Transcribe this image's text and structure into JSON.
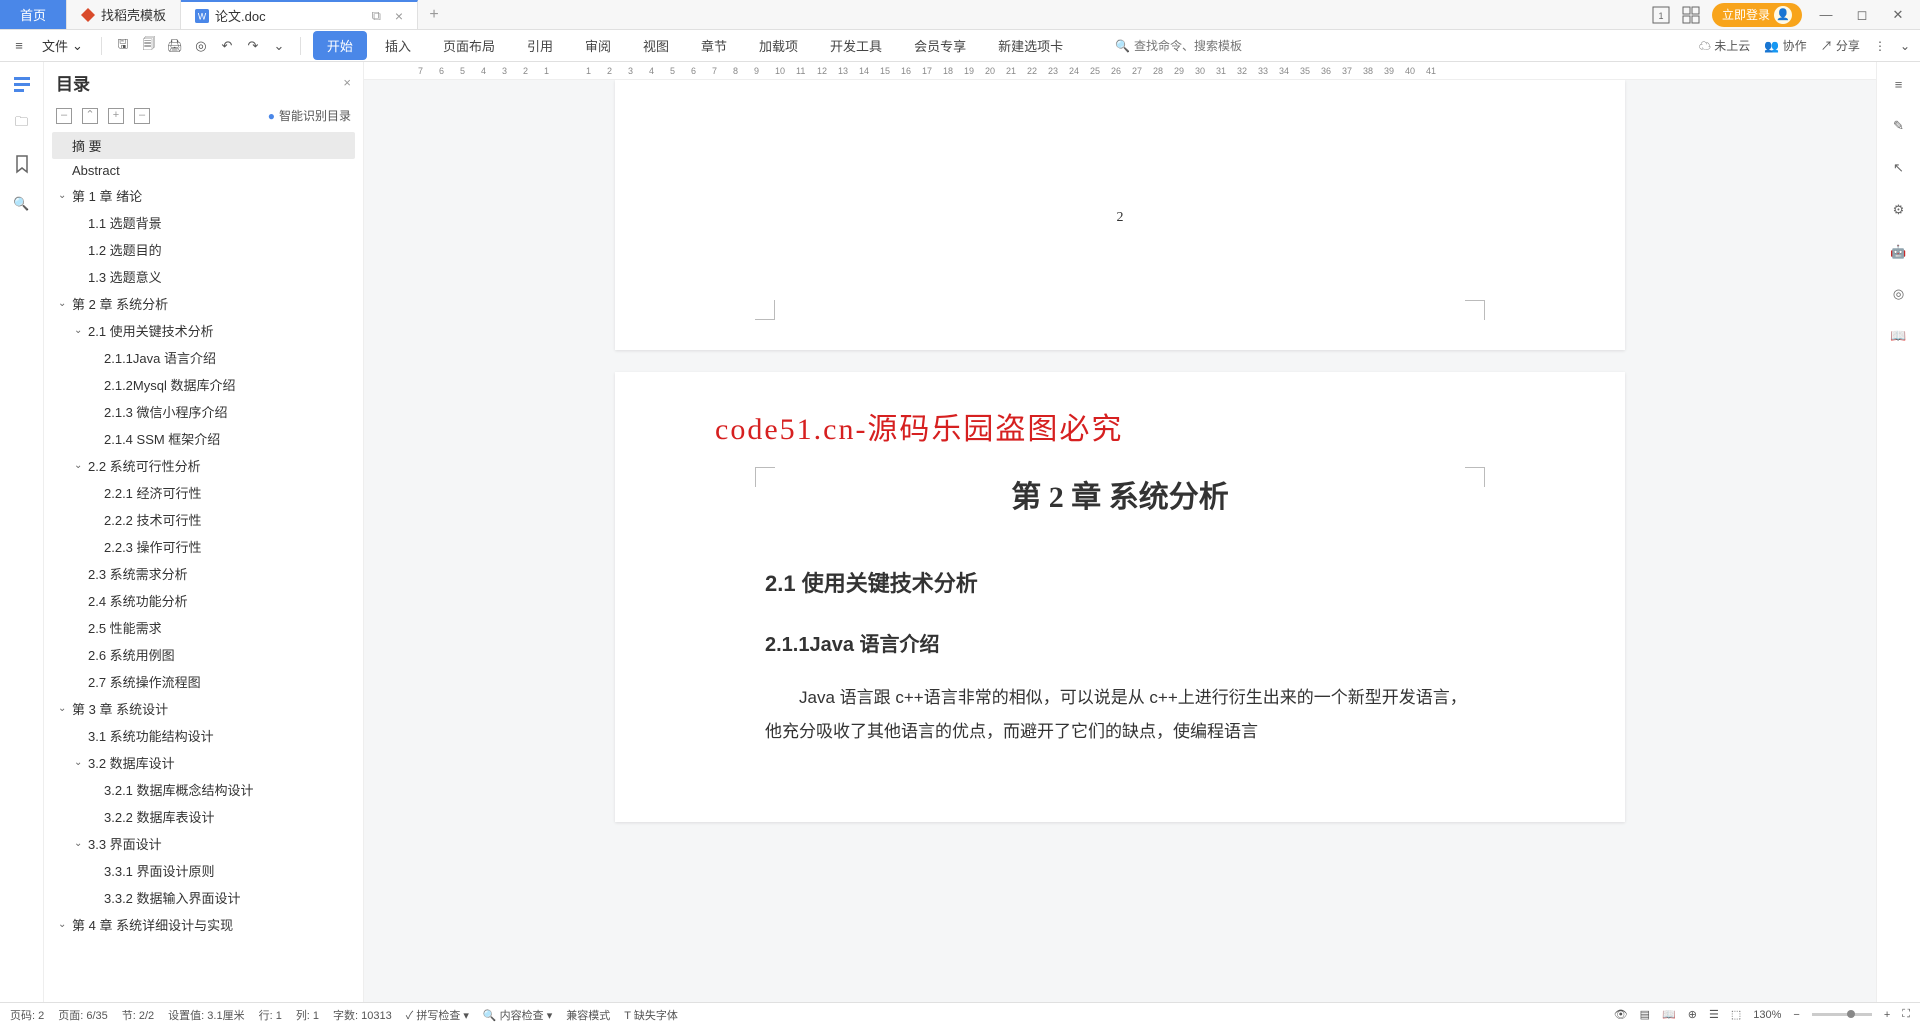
{
  "tabs": {
    "home": "首页",
    "template": "找稻壳模板",
    "doc": "论文.doc"
  },
  "titlebar": {
    "login": "立即登录"
  },
  "toolbar": {
    "file": "文件"
  },
  "ribbon": {
    "tabs": [
      "开始",
      "插入",
      "页面布局",
      "引用",
      "审阅",
      "视图",
      "章节",
      "加载项",
      "开发工具",
      "会员专享",
      "新建选项卡"
    ],
    "search_placeholder": "查找命令、搜索模板",
    "cloud": "未上云",
    "collab": "协作",
    "share": "分享"
  },
  "outline": {
    "title": "目录",
    "smart": "智能识别目录",
    "items": [
      {
        "level": 1,
        "label": "摘 要",
        "chev": "",
        "sel": true
      },
      {
        "level": 1,
        "label": "Abstract",
        "chev": ""
      },
      {
        "level": 1,
        "label": "第 1 章  绪论",
        "chev": "v"
      },
      {
        "level": 2,
        "label": "1.1 选题背景",
        "chev": ""
      },
      {
        "level": 2,
        "label": "1.2 选题目的",
        "chev": ""
      },
      {
        "level": 2,
        "label": "1.3 选题意义",
        "chev": ""
      },
      {
        "level": 1,
        "label": "第 2 章  系统分析",
        "chev": "v"
      },
      {
        "level": 2,
        "label": "2.1 使用关键技术分析",
        "chev": "v"
      },
      {
        "level": 3,
        "label": "2.1.1Java 语言介绍",
        "chev": ""
      },
      {
        "level": 3,
        "label": "2.1.2Mysql 数据库介绍",
        "chev": ""
      },
      {
        "level": 3,
        "label": "2.1.3 微信小程序介绍",
        "chev": ""
      },
      {
        "level": 3,
        "label": "2.1.4 SSM 框架介绍",
        "chev": ""
      },
      {
        "level": 2,
        "label": "2.2 系统可行性分析",
        "chev": "v"
      },
      {
        "level": 3,
        "label": "2.2.1 经济可行性",
        "chev": ""
      },
      {
        "level": 3,
        "label": "2.2.2 技术可行性",
        "chev": ""
      },
      {
        "level": 3,
        "label": "2.2.3 操作可行性",
        "chev": ""
      },
      {
        "level": 2,
        "label": "2.3 系统需求分析",
        "chev": ""
      },
      {
        "level": 2,
        "label": "2.4 系统功能分析",
        "chev": ""
      },
      {
        "level": 2,
        "label": "2.5 性能需求",
        "chev": ""
      },
      {
        "level": 2,
        "label": "2.6 系统用例图",
        "chev": ""
      },
      {
        "level": 2,
        "label": "2.7 系统操作流程图",
        "chev": ""
      },
      {
        "level": 1,
        "label": "第 3 章  系统设计",
        "chev": "v"
      },
      {
        "level": 2,
        "label": "3.1 系统功能结构设计",
        "chev": ""
      },
      {
        "level": 2,
        "label": "3.2 数据库设计",
        "chev": "v"
      },
      {
        "level": 3,
        "label": "3.2.1 数据库概念结构设计",
        "chev": ""
      },
      {
        "level": 3,
        "label": "3.2.2 数据库表设计",
        "chev": ""
      },
      {
        "level": 2,
        "label": "3.3 界面设计",
        "chev": "v"
      },
      {
        "level": 3,
        "label": "3.3.1 界面设计原则",
        "chev": ""
      },
      {
        "level": 3,
        "label": "3.3.2 数据输入界面设计",
        "chev": ""
      },
      {
        "level": 1,
        "label": "第 4 章  系统详细设计与实现",
        "chev": "v"
      }
    ]
  },
  "ruler_ticks": [
    "7",
    "6",
    "5",
    "4",
    "3",
    "2",
    "1",
    "",
    "1",
    "2",
    "3",
    "4",
    "5",
    "6",
    "7",
    "8",
    "9",
    "10",
    "11",
    "12",
    "13",
    "14",
    "15",
    "16",
    "17",
    "18",
    "19",
    "20",
    "21",
    "22",
    "23",
    "24",
    "25",
    "26",
    "27",
    "28",
    "29",
    "30",
    "31",
    "32",
    "33",
    "34",
    "35",
    "36",
    "37",
    "38",
    "39",
    "40",
    "41"
  ],
  "doc": {
    "page_number": "2",
    "watermark": "code51.cn-源码乐园盗图必究",
    "h1": "第 2 章  系统分析",
    "h2": "2.1 使用关键技术分析",
    "h3": "2.1.1Java 语言介绍",
    "p1": "Java 语言跟 c++语言非常的相似，可以说是从 c++上进行衍生出来的一个新型开发语言，他充分吸收了其他语言的优点，而避开了它们的缺点，使编程语言"
  },
  "status": {
    "page_label": "页码: 2",
    "pages": "页面: 6/35",
    "section": "节: 2/2",
    "setting": "设置值: 3.1厘米",
    "row": "行: 1",
    "col": "列: 1",
    "words": "字数: 10313",
    "spellcheck": "拼写检查",
    "content_check": "内容检查",
    "compat": "兼容模式",
    "missing_font": "缺失字体",
    "zoom": "130%"
  }
}
